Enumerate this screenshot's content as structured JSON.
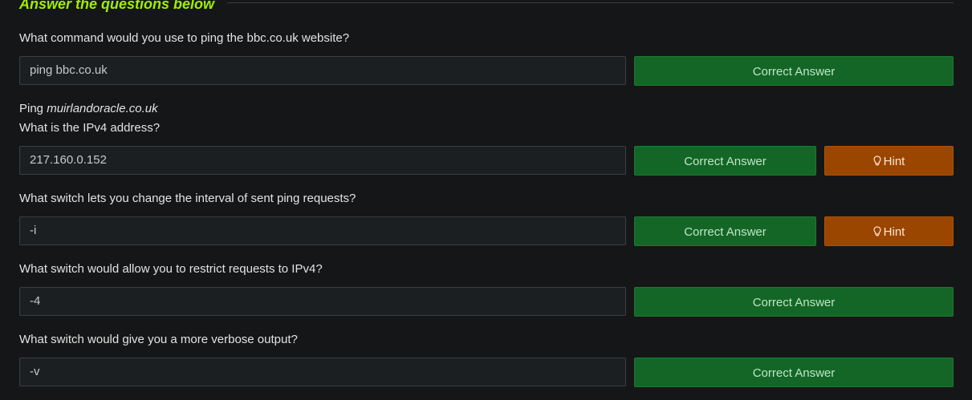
{
  "section": {
    "title": "Answer the questions below"
  },
  "questions": [
    {
      "text": "What command would you use to ping the bbc.co.uk website?",
      "answer": "ping bbc.co.uk",
      "button": "Correct Answer"
    },
    {
      "pre_text": "Ping ",
      "pre_italic": "muirlandoracle.co.uk",
      "text": "What is the IPv4 address?",
      "answer": "217.160.0.152",
      "button": "Correct Answer",
      "hint": "Hint"
    },
    {
      "text": "What switch lets you change the interval of sent ping requests?",
      "answer": "-i",
      "button": "Correct Answer",
      "hint": "Hint"
    },
    {
      "text": "What switch would allow you to restrict requests to IPv4?",
      "answer": "-4",
      "button": "Correct Answer"
    },
    {
      "text": "What switch would give you a more verbose output?",
      "answer": "-v",
      "button": "Correct Answer"
    }
  ],
  "colors": {
    "accent": "#9fef00",
    "correct": "#146627",
    "hint": "#9a4500"
  },
  "icons": {
    "hint_icon": "lightbulb-icon"
  }
}
